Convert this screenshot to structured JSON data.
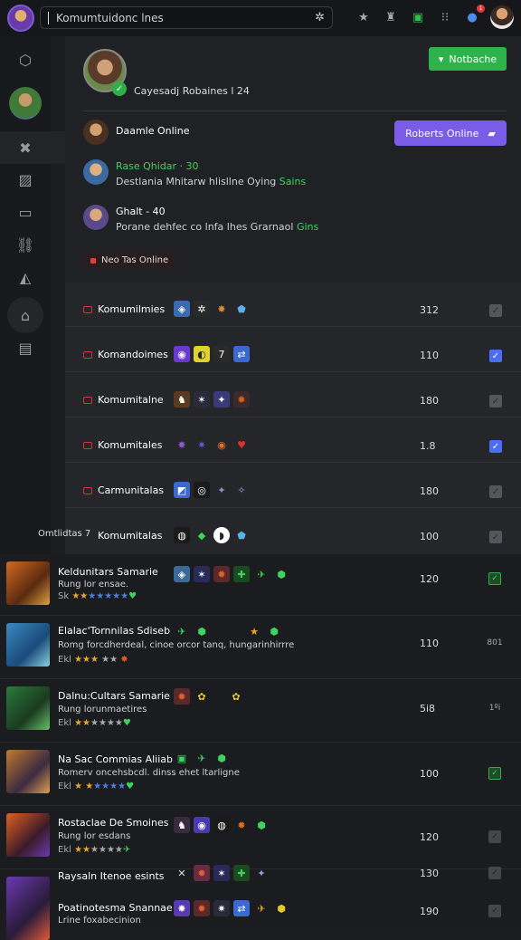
{
  "topbar": {
    "search_value": "Komumtuidonc lnes",
    "icons": [
      "app-logo",
      "search-icon",
      "pin-icon",
      "gamepad-icon",
      "controller-icon",
      "grid-icon",
      "notification-icon",
      "user-avatar"
    ],
    "notification_count": "1"
  },
  "sidebar": {
    "icons": [
      "hex-icon",
      "avatar",
      "joystick-icon",
      "chart-icon",
      "chat-icon",
      "link-icon",
      "megaphone-icon",
      "home-icon",
      "inbox-icon"
    ]
  },
  "hero": {
    "status_text": "Cayesadj  Robaines  l  24",
    "action_label": "Notbache"
  },
  "friends": {
    "button_label": "Roberts Online",
    "items": [
      {
        "name": "Daamle Online",
        "sub": "",
        "sub_green": ""
      },
      {
        "name": "Rase Qhidar · 30",
        "sub": "Destlania Mhitarw hlisllne Oying ",
        "sub_green": "Sains"
      },
      {
        "name": "Ghalt - 40",
        "sub": "Porane dehfec co lnfa lhes Grarnaol ",
        "sub_green": "Gins"
      }
    ],
    "status_pill": "Neo Tas Online"
  },
  "groups": [
    {
      "name": "Komumilmies",
      "count": "312",
      "checked": "grey"
    },
    {
      "name": "Komandoimes",
      "count": "110",
      "checked": "blue"
    },
    {
      "name": "Komumitalne",
      "count": "180",
      "checked": "grey"
    },
    {
      "name": "Komumitales",
      "count": "1.8",
      "checked": "blue"
    },
    {
      "name": "Carmunitalas",
      "count": "180",
      "checked": "grey"
    },
    {
      "name": "Komumitalas",
      "count": "100",
      "checked": "grey",
      "prefix": "Omtlidtas 7"
    }
  ],
  "games": [
    {
      "title": "Keldunitars Samarie",
      "desc": "Rung lor ensae.",
      "stars": "Sk",
      "count": "120",
      "check": "green"
    },
    {
      "title": "Elalac'Tornnilas Sdiseb",
      "desc": "Romg forcdherdeal, cinoe orcor tanq, hungarinhirrre",
      "stars": "Ekl",
      "count": "110",
      "check": "text",
      "check_text": "801"
    },
    {
      "title": "Dalnu:Cultars Samarie",
      "desc": "Rung lorunmaetires",
      "stars": "Ekl",
      "count": "5i8",
      "check": "text",
      "check_text": "1ºi"
    },
    {
      "title": "Na Sac Commias Aliiab",
      "desc": "Romerv oncehsbcdl. dinss ehet ltarligne",
      "stars": "Ekl",
      "count": "100",
      "check": "green"
    },
    {
      "title": "Rostaclae De Smoines",
      "desc": "Rung lor esdans",
      "stars": "Ekl",
      "count": "120",
      "check": "grey"
    },
    {
      "title": "Raysaln Itenoe esints",
      "desc": "",
      "stars": "",
      "count": "130",
      "check": "grey"
    },
    {
      "title": "Poatinotesma Snannae",
      "desc": "Lrine foxabecinion",
      "stars": "",
      "count": "190",
      "check": "grey"
    }
  ]
}
